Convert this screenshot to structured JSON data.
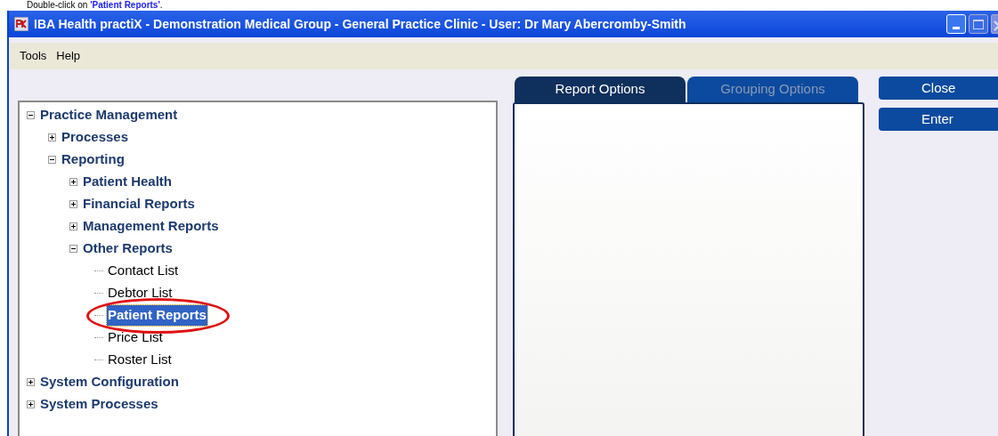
{
  "instruction": "Double-click on **'Patient Reports'**.",
  "window": {
    "title": "IBA Health practiX - Demonstration Medical Group - General Practice Clinic - User: Dr Mary Abercromby-Smith"
  },
  "menu": [
    "Tools",
    "Help"
  ],
  "tree": [
    {
      "label": "Practice Management",
      "expanded": true,
      "selected": false,
      "children": [
        {
          "label": "Processes",
          "expanded": false,
          "selected": false
        },
        {
          "label": "Reporting",
          "expanded": true,
          "selected": false,
          "children": [
            {
              "label": "Patient Health",
              "expanded": false,
              "selected": false
            },
            {
              "label": "Financial Reports",
              "expanded": false,
              "selected": false
            },
            {
              "label": "Management Reports",
              "expanded": false,
              "selected": false
            },
            {
              "label": "Other Reports",
              "expanded": true,
              "selected": false,
              "children": [
                {
                  "label": "Contact List",
                  "selected": false
                },
                {
                  "label": "Debtor List",
                  "selected": false
                },
                {
                  "label": "Patient Reports",
                  "selected": true
                },
                {
                  "label": "Price List",
                  "selected": false
                },
                {
                  "label": "Roster List",
                  "selected": false
                }
              ]
            }
          ]
        }
      ]
    },
    {
      "label": "System Configuration",
      "expanded": false,
      "selected": false
    },
    {
      "label": "System Processes",
      "expanded": false,
      "selected": false
    }
  ],
  "tabs": [
    {
      "label": "Report Options",
      "selected": true
    },
    {
      "label": "Grouping Options",
      "selected": false
    }
  ],
  "buttons": [
    "Close",
    "Enter"
  ]
}
